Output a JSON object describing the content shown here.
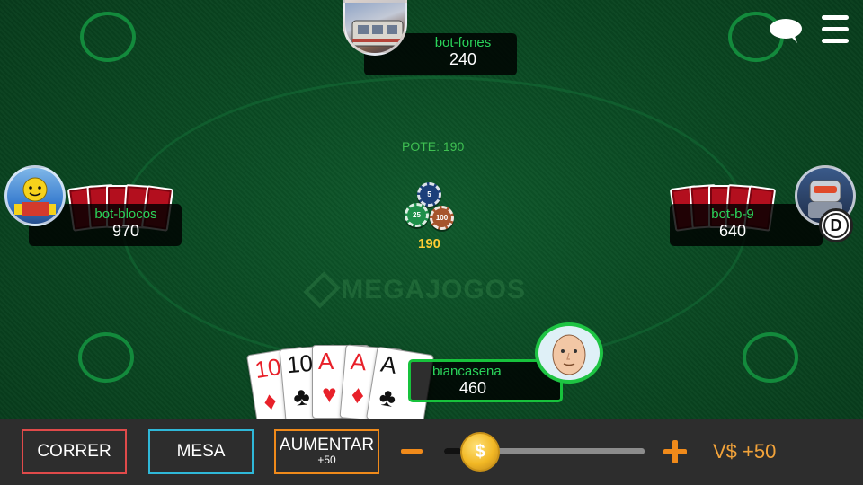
{
  "table": {
    "pot_label": "POTE: 190",
    "pot_amount": "190",
    "watermark": "MEGAJOGOS",
    "chips": [
      {
        "color": "#1c3f7a",
        "value": "5"
      },
      {
        "color": "#1e8f4a",
        "value": "25"
      },
      {
        "color": "#a6542c",
        "value": "100"
      }
    ]
  },
  "players": {
    "top": {
      "name": "bot-fones",
      "chips": "240",
      "avatar": "tram-avatar-icon"
    },
    "left": {
      "name": "bot-blocos",
      "chips": "970",
      "avatar": "lego-figure-avatar-icon"
    },
    "right": {
      "name": "bot-b-9",
      "chips": "640",
      "avatar": "robot-avatar-icon",
      "dealer": "D"
    },
    "me": {
      "name": "biancasena",
      "chips": "460",
      "avatar": "bald-man-avatar-icon"
    }
  },
  "hand": [
    {
      "rank": "10",
      "suit": "♦",
      "color": "red"
    },
    {
      "rank": "10",
      "suit": "♣",
      "color": "black"
    },
    {
      "rank": "A",
      "suit": "♥",
      "color": "red"
    },
    {
      "rank": "A",
      "suit": "♦",
      "color": "red"
    },
    {
      "rank": "A",
      "suit": "♣",
      "color": "black"
    }
  ],
  "controls": {
    "fold_label": "CORRER",
    "table_label": "MESA",
    "raise_label": "AUMENTAR",
    "raise_sub": "+50",
    "slider_minus": "minus-icon",
    "slider_plus": "plus-icon",
    "slider_knob": "$",
    "slider_level": 0.09,
    "raise_value": "V$ +50"
  },
  "top_icons": [
    "chat-bubble-icon",
    "hamburger-menu-icon"
  ],
  "colors": {
    "name_green": "#2ad45a",
    "fold_border": "#e04a4a",
    "table_border": "#2fb8d8",
    "raise_border": "#f08a1a",
    "card_back": "#b30f1e",
    "pot_gold": "#ffcc33"
  }
}
